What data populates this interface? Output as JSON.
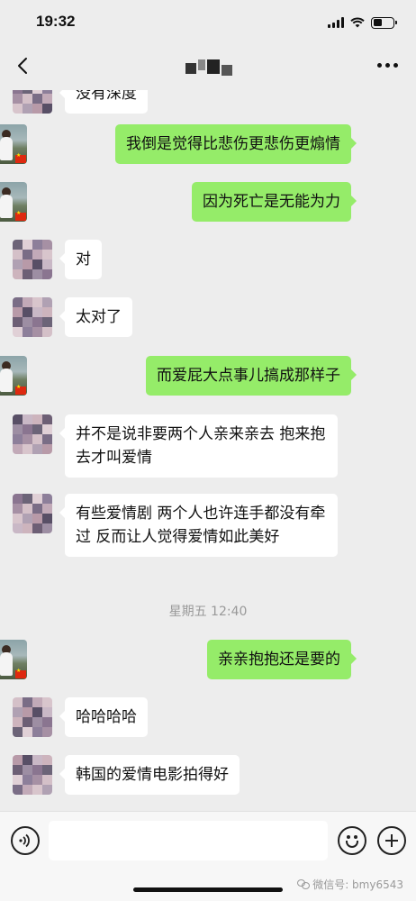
{
  "status_bar": {
    "time": "19:32",
    "battery_level": 0.45
  },
  "nav": {
    "title_redacted": true,
    "back_icon": "chevron-left-icon",
    "more_icon": "ellipsis-icon"
  },
  "messages": [
    {
      "side": "in",
      "text": "没有深度",
      "partial": true
    },
    {
      "side": "out",
      "text": "我倒是觉得比悲伤更悲伤更煽情"
    },
    {
      "side": "out",
      "text": "因为死亡是无能为力"
    },
    {
      "side": "in",
      "text": "对"
    },
    {
      "side": "in",
      "text": "太对了"
    },
    {
      "side": "out",
      "text": "而爱屁大点事儿搞成那样子"
    },
    {
      "side": "in",
      "text": "并不是说非要两个人亲来亲去 抱来抱去才叫爱情"
    },
    {
      "side": "in",
      "text": "有些爱情剧 两个人也许连手都没有牵过 反而让人觉得爱情如此美好"
    },
    {
      "side": "out",
      "text": "亲亲抱抱还是要的"
    },
    {
      "side": "in",
      "text": "哈哈哈哈"
    },
    {
      "side": "in",
      "text": "韩国的爱情电影拍得好"
    }
  ],
  "timestamp": "星期五 12:40",
  "input_bar": {
    "placeholder": "",
    "voice_icon": "voice-icon",
    "emoji_icon": "emoji-icon",
    "plus_icon": "plus-icon"
  },
  "watermark": "微信号: bmy6543",
  "colors": {
    "outgoing_bubble": "#95ec69",
    "incoming_bubble": "#ffffff",
    "background": "#ededed"
  }
}
